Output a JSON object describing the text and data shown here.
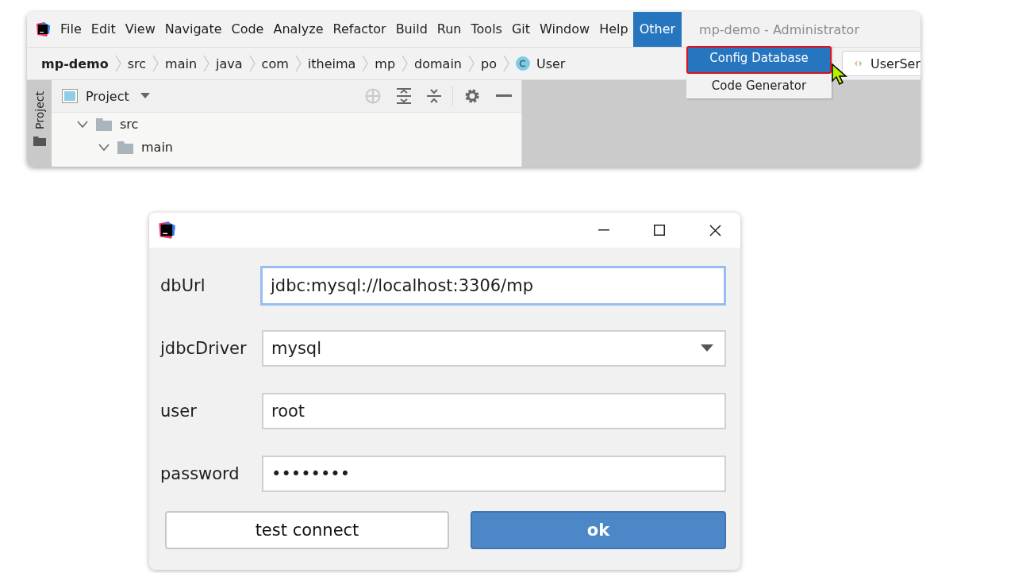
{
  "ide": {
    "menu": [
      {
        "label": "File",
        "selected": false
      },
      {
        "label": "Edit",
        "selected": false
      },
      {
        "label": "View",
        "selected": false
      },
      {
        "label": "Navigate",
        "selected": false
      },
      {
        "label": "Code",
        "selected": false
      },
      {
        "label": "Analyze",
        "selected": false
      },
      {
        "label": "Refactor",
        "selected": false
      },
      {
        "label": "Build",
        "selected": false
      },
      {
        "label": "Run",
        "selected": false
      },
      {
        "label": "Tools",
        "selected": false
      },
      {
        "label": "Git",
        "selected": false
      },
      {
        "label": "Window",
        "selected": false
      },
      {
        "label": "Help",
        "selected": false
      },
      {
        "label": "Other",
        "selected": true
      }
    ],
    "window_title": "mp-demo - Administrator",
    "breadcrumb": [
      {
        "label": "mp-demo",
        "kind": "project"
      },
      {
        "label": "src",
        "kind": "folder"
      },
      {
        "label": "main",
        "kind": "folder"
      },
      {
        "label": "java",
        "kind": "folder"
      },
      {
        "label": "com",
        "kind": "folder"
      },
      {
        "label": "itheima",
        "kind": "folder"
      },
      {
        "label": "mp",
        "kind": "folder"
      },
      {
        "label": "domain",
        "kind": "folder"
      },
      {
        "label": "po",
        "kind": "folder"
      },
      {
        "label": "User",
        "kind": "class"
      }
    ],
    "dropdown": [
      {
        "label": "Config Database",
        "selected": true
      },
      {
        "label": "Code Generator",
        "selected": false
      }
    ],
    "editor_tab": "UserSer",
    "side_tab": "Project",
    "project_panel": {
      "title": "Project",
      "tree": [
        {
          "label": "src",
          "expanded": true,
          "children": [
            {
              "label": "main",
              "expanded": true
            }
          ]
        }
      ]
    }
  },
  "dialog": {
    "fields": [
      {
        "label": "dbUrl",
        "value": "jdbc:mysql://localhost:3306/mp",
        "kind": "text",
        "focused": true
      },
      {
        "label": "jdbcDriver",
        "value": "mysql",
        "kind": "select",
        "focused": false
      },
      {
        "label": "user",
        "value": "root",
        "kind": "text",
        "focused": false
      },
      {
        "label": "password",
        "value": "••••••••",
        "kind": "text",
        "focused": false
      }
    ],
    "buttons": [
      {
        "label": "test connect",
        "primary": false
      },
      {
        "label": "ok",
        "primary": true
      }
    ]
  }
}
